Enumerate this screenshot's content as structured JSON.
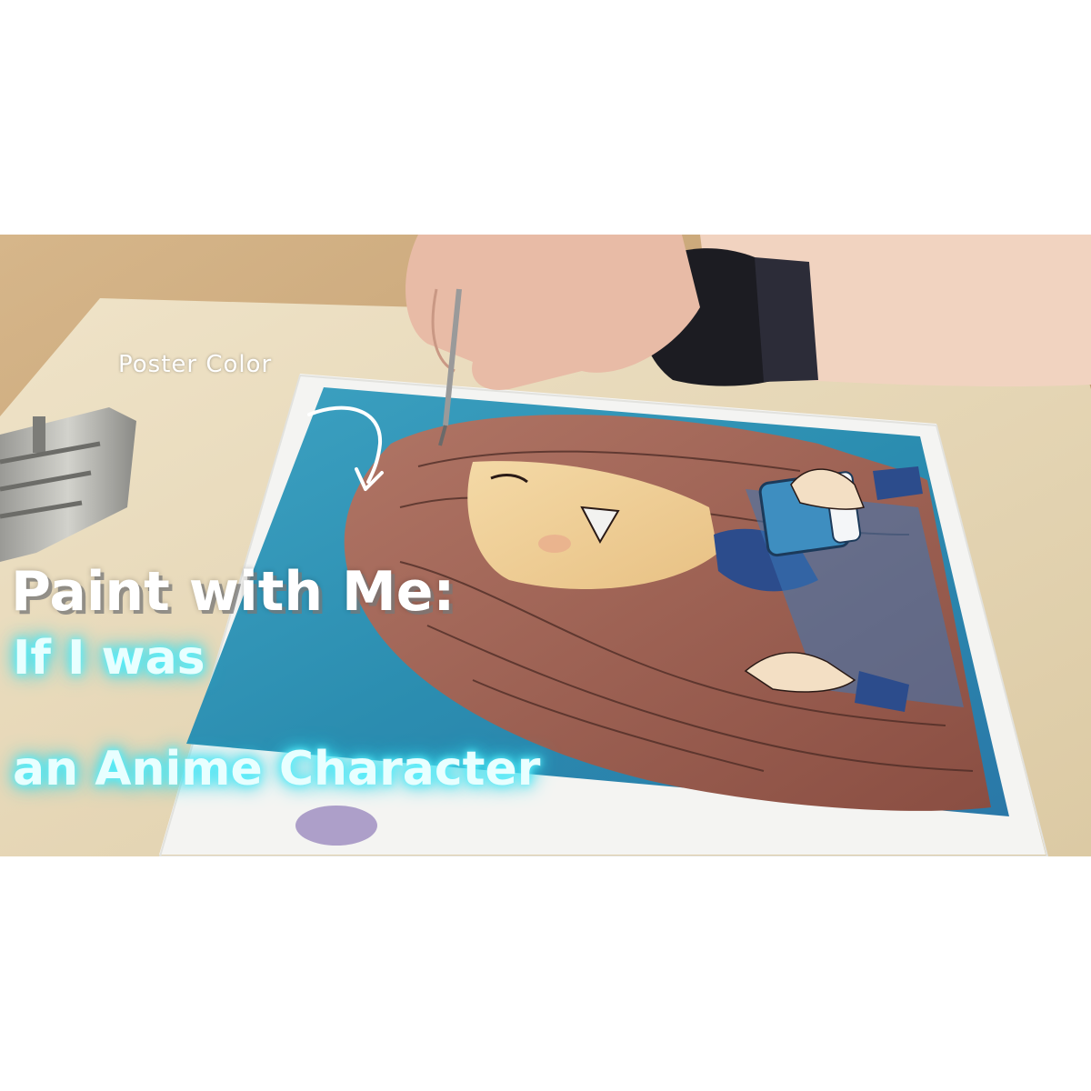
{
  "overlay": {
    "label": "Poster Color",
    "title_line1": "Paint with Me:",
    "title_line2": "If I was",
    "title_line3": "an Anime Character"
  },
  "colors": {
    "background": "#ffffff",
    "table": "#c9a77c",
    "painting_blue": "#2b8db0",
    "hair": "#9a5a4c",
    "glow": "#5ff3ff"
  },
  "icons": {
    "arrow": "curved-arrow-icon"
  }
}
